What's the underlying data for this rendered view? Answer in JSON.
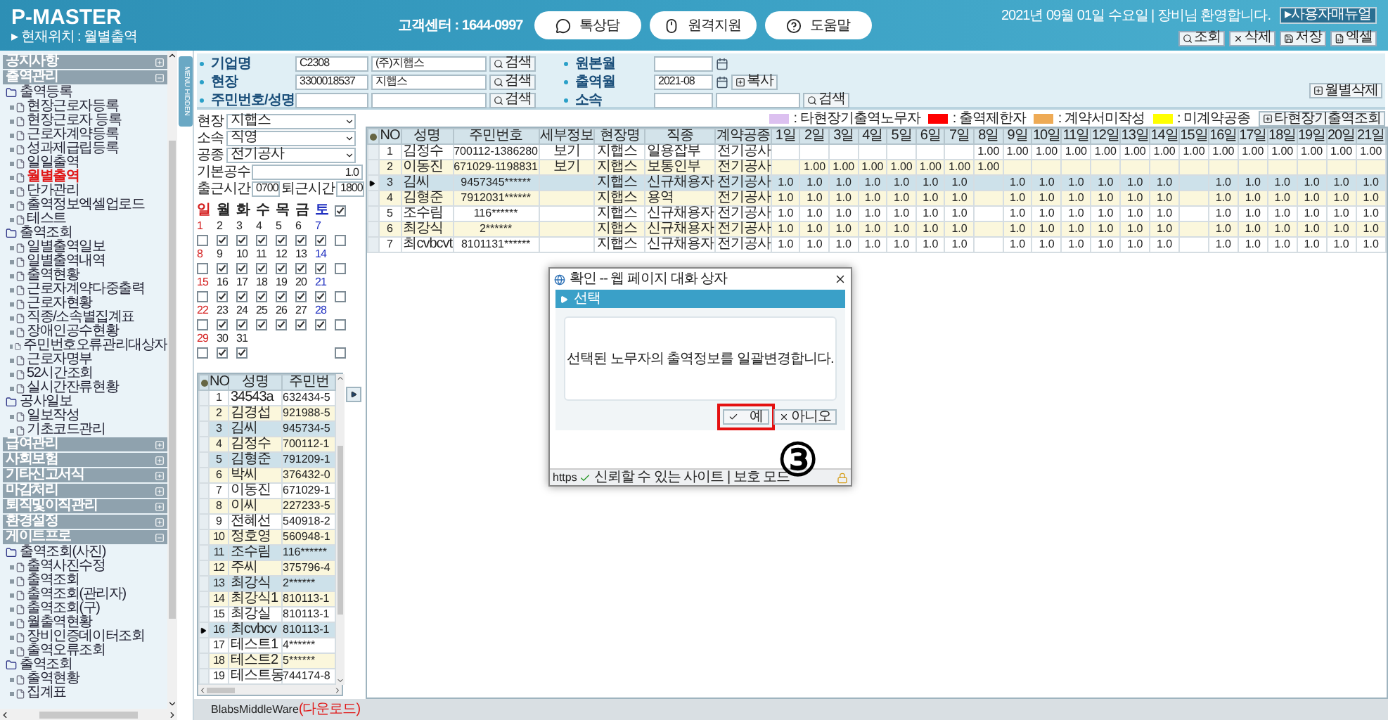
{
  "header": {
    "title": "P-MASTER",
    "location": "▸ 현재위치 : 월별출역",
    "support": "고객센터 : 1644-0997",
    "buttons": [
      {
        "label": "톡상담",
        "kind": "chat"
      },
      {
        "label": "원격지원",
        "kind": "mouse"
      },
      {
        "label": "도움말",
        "kind": "help"
      }
    ],
    "greeting": "2021년 09월 01일 수요일 | 장비님 환영합니다.",
    "manual_button": "▸사용자매뉴얼",
    "tools": [
      {
        "label": "조회",
        "kind": "search"
      },
      {
        "label": "삭제",
        "kind": "delete"
      },
      {
        "label": "저장",
        "kind": "save"
      },
      {
        "label": "엑셀",
        "kind": "excel"
      }
    ]
  },
  "sidebar": {
    "hide_tab": "MENU HIDDEN",
    "sections": [
      {
        "label": "공지사항"
      },
      {
        "label": "출역관리",
        "groups": [
          {
            "label": "출역등록",
            "items": [
              {
                "label": "현장근로자등록",
                "selected": false
              },
              {
                "label": "현장근로자 등록",
                "selected": false
              },
              {
                "label": "근로자계약등록",
                "selected": false
              },
              {
                "label": "성과제급립등록",
                "selected": false
              },
              {
                "label": "일일출역",
                "selected": false
              },
              {
                "label": "월별출역",
                "selected": true
              },
              {
                "label": "단가관리",
                "selected": false
              },
              {
                "label": "출역정보엑셀업로드",
                "selected": false
              },
              {
                "label": "테스트",
                "selected": false
              }
            ]
          },
          {
            "label": "출역조회",
            "items": [
              {
                "label": "일별출역일보",
                "selected": false
              },
              {
                "label": "일별출역내역",
                "selected": false
              },
              {
                "label": "출역현황",
                "selected": false
              },
              {
                "label": "근로자계약다중출력",
                "selected": false
              },
              {
                "label": "근로자현황",
                "selected": false
              },
              {
                "label": "직종/소속별집계표",
                "selected": false
              },
              {
                "label": "장애인공수현황",
                "selected": false
              },
              {
                "label": "주민번호오류관리대상자",
                "selected": false
              },
              {
                "label": "근로자명부",
                "selected": false
              },
              {
                "label": "52시간조회",
                "selected": false
              },
              {
                "label": "실시간잔류현황",
                "selected": false
              }
            ]
          },
          {
            "label": "공사일보",
            "items": [
              {
                "label": "일보작성",
                "selected": false
              },
              {
                "label": "기초코드관리",
                "selected": false
              }
            ]
          }
        ]
      },
      {
        "label": "급여관리"
      },
      {
        "label": "사회보험"
      },
      {
        "label": "기타신고서식"
      },
      {
        "label": "마감처리"
      },
      {
        "label": "퇴직및이직관리"
      },
      {
        "label": "환경설정"
      },
      {
        "label": "게이트프로",
        "groups": [
          {
            "label": "출역조회(사진)",
            "items": [
              {
                "label": "출역사진수정",
                "selected": false
              },
              {
                "label": "출역조회",
                "selected": false
              },
              {
                "label": "출역조회(관리자)",
                "selected": false
              },
              {
                "label": "출역조회(구)",
                "selected": false
              },
              {
                "label": "월출역현황",
                "selected": false
              },
              {
                "label": "장비인증데이터조회",
                "selected": false
              },
              {
                "label": "출역오류조회",
                "selected": false
              }
            ]
          },
          {
            "label": "출역조회",
            "items": [
              {
                "label": "출역현황",
                "selected": false
              },
              {
                "label": "집계표",
                "selected": false
              }
            ]
          }
        ]
      }
    ]
  },
  "form": {
    "left": [
      {
        "label": "기업명",
        "code": "C2308",
        "name": "(주)지햅스",
        "button": "검색"
      },
      {
        "label": "현장",
        "code": "3300018537",
        "name": "지햅스",
        "button": "검색"
      },
      {
        "label": "주민번호/성명",
        "button": "검색"
      }
    ],
    "middle": [
      {
        "label": "원본월",
        "kind": "month"
      },
      {
        "label": "출역월",
        "kind": "month",
        "value": "2021-08",
        "button": "복사"
      },
      {
        "label": "소속",
        "kind": "pair",
        "button": "검색"
      }
    ],
    "delete_button": "월별삭제"
  },
  "filter": {
    "selects": [
      {
        "label": "현장",
        "value": "지햅스"
      },
      {
        "label": "소속",
        "value": "직영"
      },
      {
        "label": "공종",
        "value": "전기공사"
      }
    ],
    "base": {
      "label": "기본공수",
      "value": "1.0"
    },
    "times": {
      "in_label": "출근시간",
      "in_value": "0700",
      "out_label": "퇴근시간",
      "out_value": "1800"
    }
  },
  "calendar": {
    "all_checked": true,
    "weekdays": [
      {
        "label": "일",
        "kind": "sun"
      },
      {
        "label": "월",
        "kind": "day"
      },
      {
        "label": "화",
        "kind": "day"
      },
      {
        "label": "수",
        "kind": "day"
      },
      {
        "label": "목",
        "kind": "day"
      },
      {
        "label": "금",
        "kind": "day"
      },
      {
        "label": "토",
        "kind": "sat"
      }
    ],
    "weeks": [
      {
        "checked": false,
        "days": [
          {
            "label": "1",
            "kind": "sun",
            "checked": false
          },
          {
            "label": "2",
            "kind": "day",
            "checked": true
          },
          {
            "label": "3",
            "kind": "day",
            "checked": true
          },
          {
            "label": "4",
            "kind": "day",
            "checked": true
          },
          {
            "label": "5",
            "kind": "day",
            "checked": true
          },
          {
            "label": "6",
            "kind": "day",
            "checked": true
          },
          {
            "label": "7",
            "kind": "sat",
            "checked": true
          }
        ]
      },
      {
        "checked": false,
        "days": [
          {
            "label": "8",
            "kind": "sun",
            "checked": false
          },
          {
            "label": "9",
            "kind": "day",
            "checked": true
          },
          {
            "label": "10",
            "kind": "day",
            "checked": true
          },
          {
            "label": "11",
            "kind": "day",
            "checked": true
          },
          {
            "label": "12",
            "kind": "day",
            "checked": true
          },
          {
            "label": "13",
            "kind": "day",
            "checked": true
          },
          {
            "label": "14",
            "kind": "sat",
            "checked": true
          }
        ]
      },
      {
        "checked": false,
        "days": [
          {
            "label": "15",
            "kind": "sun",
            "checked": false
          },
          {
            "label": "16",
            "kind": "day",
            "checked": true
          },
          {
            "label": "17",
            "kind": "day",
            "checked": true
          },
          {
            "label": "18",
            "kind": "day",
            "checked": true
          },
          {
            "label": "19",
            "kind": "day",
            "checked": true
          },
          {
            "label": "20",
            "kind": "day",
            "checked": true
          },
          {
            "label": "21",
            "kind": "sat",
            "checked": true
          }
        ]
      },
      {
        "checked": false,
        "days": [
          {
            "label": "22",
            "kind": "sun",
            "checked": false
          },
          {
            "label": "23",
            "kind": "day",
            "checked": true
          },
          {
            "label": "24",
            "kind": "day",
            "checked": true
          },
          {
            "label": "25",
            "kind": "day",
            "checked": true
          },
          {
            "label": "26",
            "kind": "day",
            "checked": true
          },
          {
            "label": "27",
            "kind": "day",
            "checked": true
          },
          {
            "label": "28",
            "kind": "sat",
            "checked": true
          }
        ]
      },
      {
        "checked": false,
        "days": [
          {
            "label": "29",
            "kind": "sun",
            "checked": false
          },
          {
            "label": "30",
            "kind": "day",
            "checked": true
          },
          {
            "label": "31",
            "kind": "day",
            "checked": true
          }
        ]
      }
    ]
  },
  "workers": {
    "columns": [
      "NO",
      "성명",
      "주민번"
    ],
    "rows": [
      {
        "no": "1",
        "name": "34543a",
        "id": "632434-5",
        "selected": false,
        "current": false
      },
      {
        "no": "2",
        "name": "김경섭",
        "id": "921988-5",
        "selected": false,
        "current": false
      },
      {
        "no": "3",
        "name": "김씨",
        "id": "945734-5",
        "selected": true,
        "current": false
      },
      {
        "no": "4",
        "name": "김정수",
        "id": "700112-1",
        "selected": false,
        "current": false
      },
      {
        "no": "5",
        "name": "김형준",
        "id": "791209-1",
        "selected": true,
        "current": false
      },
      {
        "no": "6",
        "name": "박씨",
        "id": "376432-0",
        "selected": false,
        "current": false
      },
      {
        "no": "7",
        "name": "이동진",
        "id": "671029-1",
        "selected": false,
        "current": false
      },
      {
        "no": "8",
        "name": "이씨",
        "id": "227233-5",
        "selected": false,
        "current": false
      },
      {
        "no": "9",
        "name": "전혜선",
        "id": "540918-2",
        "selected": false,
        "current": false
      },
      {
        "no": "10",
        "name": "정호영",
        "id": "560948-1",
        "selected": false,
        "current": false
      },
      {
        "no": "11",
        "name": "조수림",
        "id": "116******",
        "selected": true,
        "current": false
      },
      {
        "no": "12",
        "name": "주씨",
        "id": "375796-4",
        "selected": false,
        "current": false
      },
      {
        "no": "13",
        "name": "최강식",
        "id": "2******",
        "selected": true,
        "current": false
      },
      {
        "no": "14",
        "name": "최강식1",
        "id": "810113-1",
        "selected": false,
        "current": false
      },
      {
        "no": "15",
        "name": "최강실",
        "id": "810113-1",
        "selected": false,
        "current": false
      },
      {
        "no": "16",
        "name": "최cvbcv",
        "id": "810113-1",
        "selected": true,
        "current": true
      },
      {
        "no": "17",
        "name": "테스트1",
        "id": "4******",
        "selected": false,
        "current": false
      },
      {
        "no": "18",
        "name": "테스트2",
        "id": "5******",
        "selected": false,
        "current": false
      },
      {
        "no": "19",
        "name": "테스트동",
        "id": "744174-8",
        "selected": false,
        "current": false
      }
    ]
  },
  "legend": {
    "items": [
      {
        "label": ": 타현장기출역노무자",
        "color": "#dcc0f0"
      },
      {
        "label": ": 출역제한자",
        "color": "#ff0000"
      },
      {
        "label": ": 계약서미작성",
        "color": "#eeaa55"
      },
      {
        "label": ": 미계약공종",
        "color": "#ffff00"
      }
    ],
    "button": "타현장기출역조회"
  },
  "grid": {
    "columns": [
      "NO",
      "성명",
      "주민번호",
      "세부정보",
      "현장명",
      "직종",
      "계약공종",
      "1일",
      "2일",
      "3일",
      "4일",
      "5일",
      "6일",
      "7일",
      "8일",
      "9일",
      "10일",
      "11일",
      "12일",
      "13일",
      "14일",
      "15일",
      "16일",
      "17일",
      "18일",
      "19일",
      "20일",
      "21일"
    ],
    "rows": [
      {
        "selected": false,
        "no": "1",
        "name": "김정수",
        "id": "700112-1386280",
        "detail": "보기",
        "site": "지햅스",
        "job": "일용잡부",
        "trade": "전기공사",
        "days": {
          "8": "1.00",
          "9": "1.00",
          "10": "1.00",
          "11": "1.00",
          "12": "1.00",
          "13": "1.00",
          "14": "1.00",
          "15": "1.00",
          "16": "1.00",
          "17": "1.00",
          "18": "1.00",
          "19": "1.00",
          "20": "1.00",
          "21": "1.00"
        }
      },
      {
        "selected": false,
        "no": "2",
        "name": "이동진",
        "id": "671029-1198831",
        "detail": "보기",
        "site": "지햅스",
        "job": "보통인부",
        "trade": "전기공사",
        "days": {
          "2": "1.00",
          "3": "1.00",
          "4": "1.00",
          "5": "1.00",
          "6": "1.00",
          "7": "1.00",
          "8": "1.00"
        }
      },
      {
        "selected": true,
        "no": "3",
        "name": "김씨",
        "id": "9457345******",
        "site": "지햅스",
        "job": "신규채용자",
        "trade": "전기공사",
        "days": {
          "1": "1.0",
          "2": "1.0",
          "3": "1.0",
          "4": "1.0",
          "5": "1.0",
          "6": "1.0",
          "7": "1.0",
          "9": "1.0",
          "10": "1.0",
          "11": "1.0",
          "12": "1.0",
          "13": "1.0",
          "14": "1.0",
          "16": "1.0",
          "17": "1.0",
          "18": "1.0",
          "19": "1.0",
          "20": "1.0",
          "21": "1.0"
        }
      },
      {
        "selected": false,
        "no": "4",
        "name": "김형준",
        "id": "7912031******",
        "site": "지햅스",
        "job": "용역",
        "trade": "전기공사",
        "days": {
          "1": "1.0",
          "2": "1.0",
          "3": "1.0",
          "4": "1.0",
          "5": "1.0",
          "6": "1.0",
          "7": "1.0",
          "9": "1.0",
          "10": "1.0",
          "11": "1.0",
          "12": "1.0",
          "13": "1.0",
          "14": "1.0",
          "16": "1.0",
          "17": "1.0",
          "18": "1.0",
          "19": "1.0",
          "20": "1.0",
          "21": "1.0"
        }
      },
      {
        "selected": false,
        "no": "5",
        "name": "조수림",
        "id": "116******",
        "site": "지햅스",
        "job": "신규채용자",
        "trade": "전기공사",
        "days": {
          "1": "1.0",
          "2": "1.0",
          "3": "1.0",
          "4": "1.0",
          "5": "1.0",
          "6": "1.0",
          "7": "1.0",
          "9": "1.0",
          "10": "1.0",
          "11": "1.0",
          "12": "1.0",
          "13": "1.0",
          "14": "1.0",
          "16": "1.0",
          "17": "1.0",
          "18": "1.0",
          "19": "1.0",
          "20": "1.0",
          "21": "1.0"
        }
      },
      {
        "selected": false,
        "no": "6",
        "name": "최강식",
        "id": "2******",
        "site": "지햅스",
        "job": "신규채용자",
        "trade": "전기공사",
        "days": {
          "1": "1.0",
          "2": "1.0",
          "3": "1.0",
          "4": "1.0",
          "5": "1.0",
          "6": "1.0",
          "7": "1.0",
          "9": "1.0",
          "10": "1.0",
          "11": "1.0",
          "12": "1.0",
          "13": "1.0",
          "14": "1.0",
          "16": "1.0",
          "17": "1.0",
          "18": "1.0",
          "19": "1.0",
          "20": "1.0",
          "21": "1.0"
        }
      },
      {
        "selected": false,
        "no": "7",
        "name": "최cvbcvt",
        "id": "8101131******",
        "site": "지햅스",
        "job": "신규채용자",
        "trade": "전기공사",
        "days": {
          "1": "1.0",
          "2": "1.0",
          "3": "1.0",
          "4": "1.0",
          "5": "1.0",
          "6": "1.0",
          "7": "1.0",
          "9": "1.0",
          "10": "1.0",
          "11": "1.0",
          "12": "1.0",
          "13": "1.0",
          "14": "1.0",
          "16": "1.0",
          "17": "1.0",
          "18": "1.0",
          "19": "1.0",
          "20": "1.0",
          "21": "1.0"
        }
      }
    ]
  },
  "dialog": {
    "title": "확인 -- 웹 페이지 대화 상자",
    "heading": "선택",
    "message": "선택된 노무자의 출역정보를 일괄변경합니다.",
    "buttons": [
      {
        "label": "예",
        "highlighted": true,
        "kind": "yes"
      },
      {
        "label": "아니오",
        "highlighted": false,
        "kind": "no"
      }
    ],
    "status": {
      "protocol": "https",
      "zone": "신뢰할 수 있는 사이트 | 보호 모드"
    },
    "step_marker": "③"
  },
  "footer": {
    "label": "BlabsMiddleWare",
    "link": "(다운로드)"
  }
}
